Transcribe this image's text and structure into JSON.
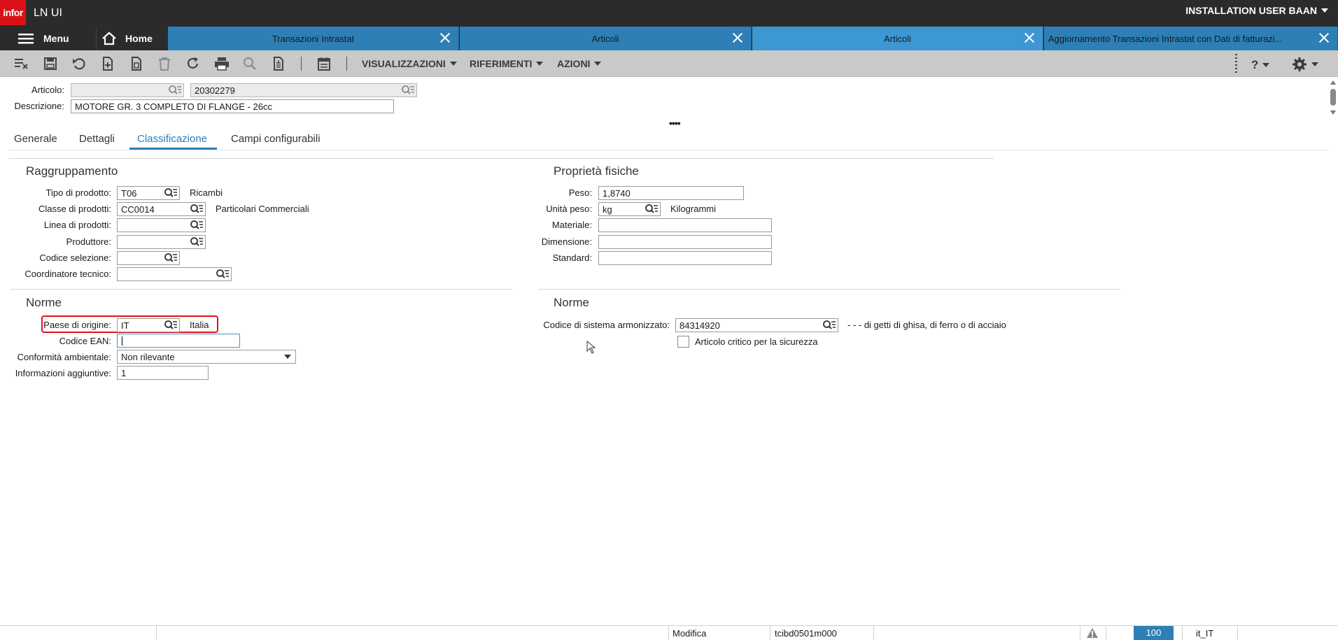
{
  "app": {
    "logo": "infor",
    "name": "LN UI",
    "user": "INSTALLATION USER BAAN"
  },
  "nav": {
    "menu_label": "Menu",
    "home_label": "Home"
  },
  "tabs": [
    {
      "label": "Transazioni Intrastat",
      "active": false
    },
    {
      "label": "Articoli",
      "active": false
    },
    {
      "label": "Articoli",
      "active": true
    },
    {
      "label": "Aggiornamento Transazioni Intrastat con Dati di fatturazi...",
      "active": false
    }
  ],
  "toolbar": {
    "menus": [
      "VISUALIZZAZIONI",
      "RIFERIMENTI",
      "AZIONI"
    ],
    "help_label": "?",
    "icons": [
      "new-group-icon",
      "save-icon",
      "undo-icon",
      "new-icon",
      "duplicate-icon",
      "delete-icon",
      "refresh-icon",
      "print-icon",
      "find-icon",
      "text-icon",
      "calendar-icon",
      "help-icon",
      "settings-icon"
    ]
  },
  "header": {
    "item_label": "Articolo:",
    "item_segment": "",
    "item_code": "20302279",
    "description_label": "Descrizione:",
    "description": "MOTORE GR. 3 COMPLETO DI FLANGE - 26cc",
    "collapse_handle": "••••"
  },
  "subtabs": [
    {
      "label": "Generale",
      "active": false
    },
    {
      "label": "Dettagli",
      "active": false
    },
    {
      "label": "Classificazione",
      "active": true
    },
    {
      "label": "Campi configurabili",
      "active": false
    }
  ],
  "grouping": {
    "title": "Raggruppamento",
    "product_type_label": "Tipo di prodotto:",
    "product_type": "T06",
    "product_type_desc": "Ricambi",
    "product_class_label": "Classe di prodotti:",
    "product_class": "CC0014",
    "product_class_desc": "Particolari Commerciali",
    "product_line_label": "Linea di prodotti:",
    "product_line": "",
    "manufacturer_label": "Produttore:",
    "manufacturer": "",
    "selection_code_label": "Codice selezione:",
    "selection_code": "",
    "tech_coordinator_label": "Coordinatore tecnico:",
    "tech_coordinator": ""
  },
  "physical": {
    "title": "Proprietà fisiche",
    "weight_label": "Peso:",
    "weight": "1,8740",
    "weight_unit_label": "Unità peso:",
    "weight_unit": "kg",
    "weight_unit_desc": "Kilogrammi",
    "material_label": "Materiale:",
    "material": "",
    "dimension_label": "Dimensione:",
    "dimension": "",
    "standard_label": "Standard:",
    "standard": ""
  },
  "norms_left": {
    "title": "Norme",
    "origin_label": "Paese di origine:",
    "origin": "IT",
    "origin_desc": "Italia",
    "ean_label": "Codice EAN:",
    "ean": "",
    "env_label": "Conformità ambientale:",
    "env": "Non rilevante",
    "info_label": "Informazioni aggiuntive:",
    "info": "1"
  },
  "norms_right": {
    "title": "Norme",
    "hs_label": "Codice di sistema armonizzato:",
    "hs": "84314920",
    "hs_desc": "- - - di getti di ghisa, di ferro o di acciaio",
    "safety_label": "Articolo critico per la sicurezza"
  },
  "status": {
    "mode": "Modifica",
    "session": "tcibd0501m000",
    "company": "100",
    "locale": "it_IT"
  },
  "colors": {
    "highlight": "#e0101e",
    "tab": "#2d7fb6",
    "tab_active": "#3d97d3"
  }
}
